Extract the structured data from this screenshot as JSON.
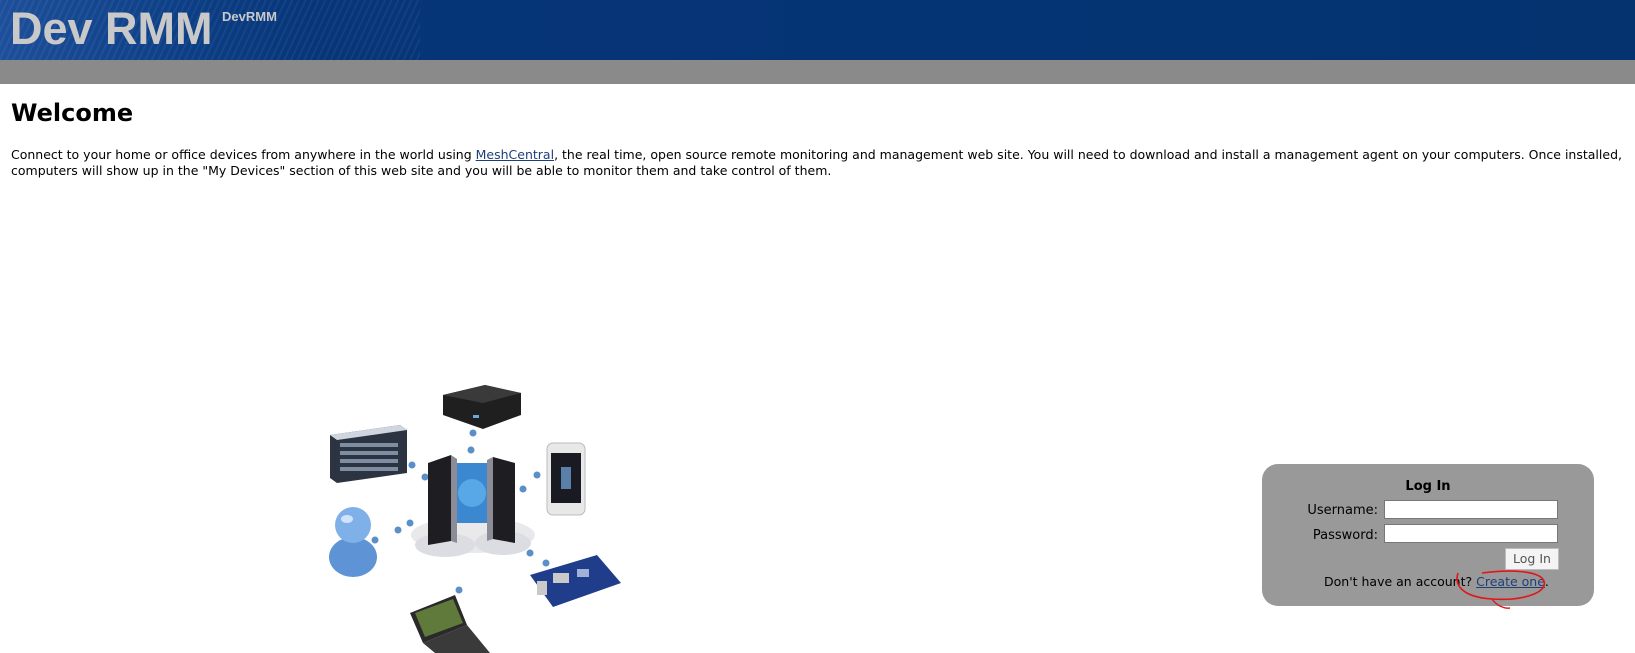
{
  "header": {
    "title": "Dev RMM",
    "subtitle": "DevRMM"
  },
  "main": {
    "heading": "Welcome",
    "intro_before_link": "Connect to your home or office devices from anywhere in the world using ",
    "intro_link": "MeshCentral",
    "intro_after_link": ", the real time, open source remote monitoring and management web site. You will need to download and install a management agent on your computers. Once installed, computers will show up in the \"My Devices\" section of this web site and you will be able to monitor them and take control of them."
  },
  "login": {
    "title": "Log In",
    "username_label": "Username:",
    "password_label": "Password:",
    "username_value": "",
    "password_value": "",
    "button_label": "Log In",
    "no_account_text": "Don't have an account? ",
    "create_link": "Create one",
    "create_suffix": "."
  },
  "colors": {
    "header_bg": "#043370",
    "gray_bar": "#8a8a8a",
    "login_box": "#999999",
    "annotation": "#e0161b"
  },
  "icons": [
    "server-rack-icon",
    "mini-pc-icon",
    "smartphone-icon",
    "user-icon",
    "central-server-icon",
    "laptop-icon",
    "circuit-board-icon"
  ]
}
